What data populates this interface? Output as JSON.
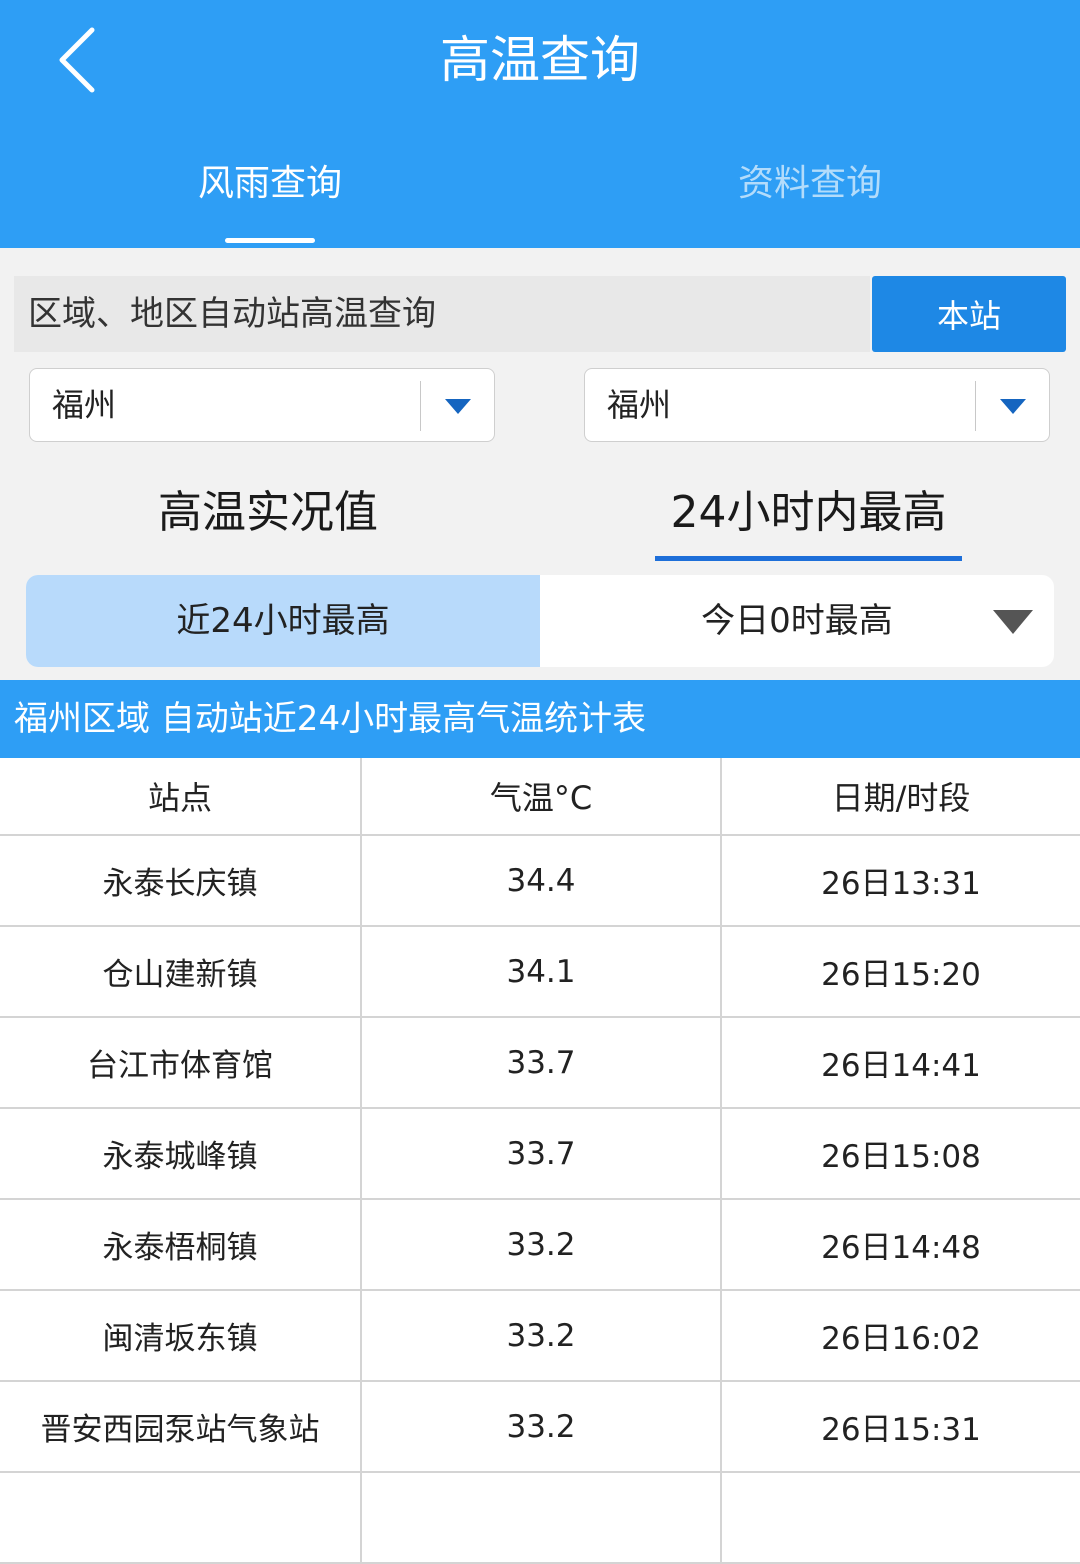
{
  "header": {
    "title": "高温查询",
    "tabs": [
      {
        "label": "风雨查询"
      },
      {
        "label": "资料查询"
      }
    ]
  },
  "query": {
    "label": "区域、地区自动站高温查询",
    "station_button": "本站",
    "select1": "福州",
    "select2": "福州"
  },
  "modes": [
    {
      "label": "高温实况值"
    },
    {
      "label": "24小时内最高"
    }
  ],
  "segments": [
    {
      "label": "近24小时最高"
    },
    {
      "label": "今日0时最高"
    }
  ],
  "table": {
    "title": "福州区域 自动站近24小时最高气温统计表",
    "headers": [
      "站点",
      "气温°C",
      "日期/时段"
    ],
    "rows": [
      [
        "永泰长庆镇",
        "34.4",
        "26日13:31"
      ],
      [
        "仓山建新镇",
        "34.1",
        "26日15:20"
      ],
      [
        "台江市体育馆",
        "33.7",
        "26日14:41"
      ],
      [
        "永泰城峰镇",
        "33.7",
        "26日15:08"
      ],
      [
        "永泰梧桐镇",
        "33.2",
        "26日14:48"
      ],
      [
        "闽清坂东镇",
        "33.2",
        "26日16:02"
      ],
      [
        "晋安西园泵站气象站",
        "33.2",
        "26日15:31"
      ],
      [
        "",
        "",
        ""
      ]
    ]
  },
  "colors": {
    "header_bg": "#2e9ef5",
    "button_bg": "#1e88e5",
    "selected_segment": "#b8dafb",
    "underline": "#1e6fd9"
  }
}
